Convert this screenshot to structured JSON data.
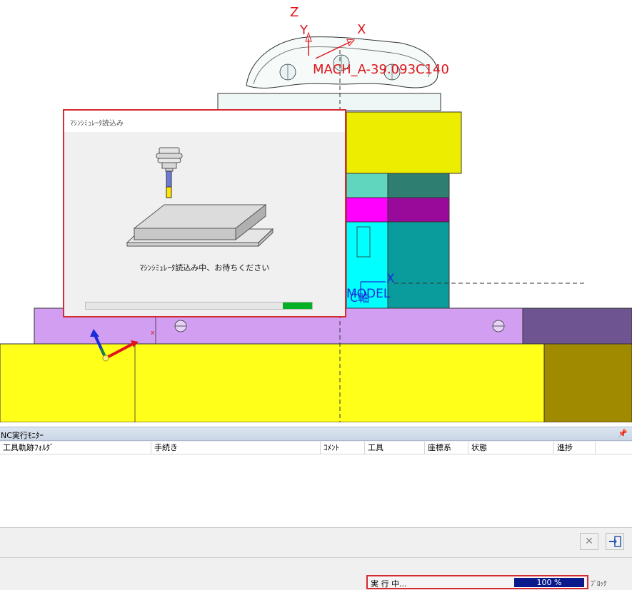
{
  "viewport": {
    "axis_labels": {
      "z": "Z",
      "y": "Y",
      "x": "X",
      "x_small": "X",
      "x_tiny": "x"
    },
    "machine_label": "MACH_A-39.093C140",
    "model_label": "MODEL",
    "axis_label_jp": "C軸",
    "colors": {
      "yellow": "#eded00",
      "magenta": "#ff00ff",
      "cyan": "#00ffff",
      "lavender": "#d29ef2",
      "teal": "#2e7f72"
    }
  },
  "dialog": {
    "title": "ﾏｼﾝｼﾐｭﾚｰﾀ読込み",
    "message": "ﾏｼﾝｼﾐｭﾚｰﾀ読込み中、お待ちください",
    "progress_fraction": 0.13
  },
  "monitor": {
    "title": "NC実行ﾓﾆﾀｰ",
    "pin_icon": "pin-icon",
    "columns": [
      "工具軌跡ﾌｫﾙﾀﾞ",
      "手続き",
      "ｺﾒﾝﾄ",
      "工具",
      "座標系",
      "状態",
      "進捗"
    ],
    "buttons": {
      "cancel": "cancel-icon",
      "exit": "exit-icon"
    }
  },
  "status": {
    "text": "実 行 中...",
    "percent_label": "100 %",
    "progress_fraction": 1.0,
    "block_label": "ﾌﾞﾛｯｸ"
  }
}
